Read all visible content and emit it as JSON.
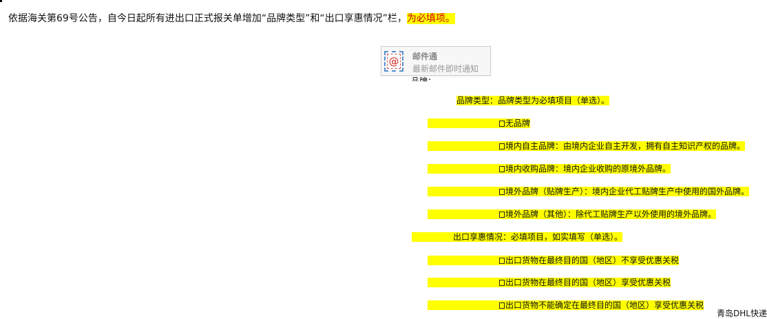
{
  "notice": {
    "text": "依据海关第69号公告，自今日起所有进出口正式报关单增加“品牌类型”和“出口享惠情况”栏，",
    "highlight": "为必填项。"
  },
  "mail_widget": {
    "icon": "mail-at-icon",
    "icon_glyph": "@",
    "title": "邮件通",
    "subtitle": "最新邮件即时通知"
  },
  "partial_label": "品牌：",
  "brand_section": {
    "heading": "品牌类型：品牌类型为必填项目（单选）。",
    "options": [
      "无品牌",
      "境内自主品牌：由境内企业自主开发，拥有自主知识产权的品牌。",
      "境内收购品牌：境内企业收购的原境外品牌。",
      "境外品牌（贴牌生产）：境内企业代工贴牌生产中使用的国外品牌。",
      "境外品牌（其他）：除代工贴牌生产以外使用的境外品牌。"
    ]
  },
  "export_section": {
    "heading": "出口享惠情况：必填项目，如实填写（单选）。",
    "options": [
      "出口货物在最终目的国（地区）不享受优惠关税",
      "出口货物在最终目的国（地区）享受优惠关税",
      "出口货物不能确定在最终目的国（地区）享受优惠关税"
    ]
  },
  "watermark": "青岛DHL快递",
  "colors": {
    "highlight": "#ffff00",
    "emphasis_text": "#d00000"
  }
}
